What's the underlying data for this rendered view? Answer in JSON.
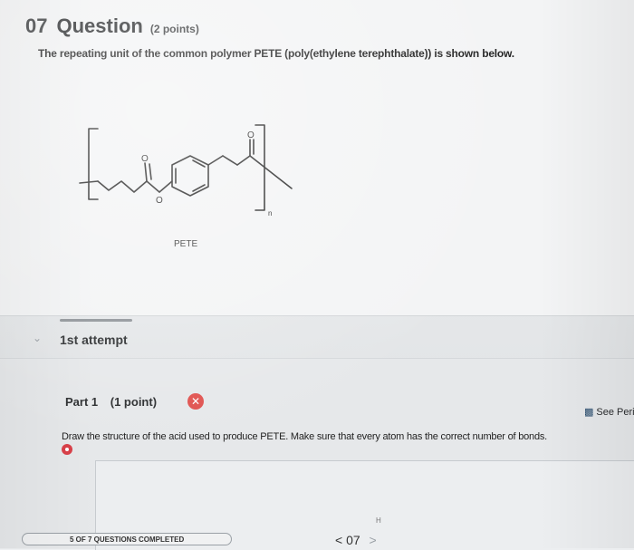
{
  "question": {
    "number": "07",
    "title": "Question",
    "points": "(2 points)",
    "prompt": "The repeating unit of the common polymer PETE (poly(ethylene terephthalate)) is shown below.",
    "structure_label": "PETE",
    "atom_labels": {
      "oxygen": "O",
      "subscript": "n"
    }
  },
  "attempt": {
    "label": "1st attempt"
  },
  "part": {
    "title": "Part 1",
    "points": "(1 point)",
    "see_link": "See Peri",
    "instructions": "Draw the structure of the acid used to produce PETE. Make sure that every atom has the correct number of bonds."
  },
  "footer": {
    "progress_text": "5 OF 7 QUESTIONS COMPLETED",
    "nav_prev": "<",
    "nav_current": "07",
    "nav_next": ">",
    "small_label": "H"
  },
  "icons": {
    "chevron": "chevron-down-icon",
    "error": "x-circle-icon",
    "chart": "chart-icon",
    "status": "status-dot-icon",
    "hand": "hand-pointer-icon"
  }
}
